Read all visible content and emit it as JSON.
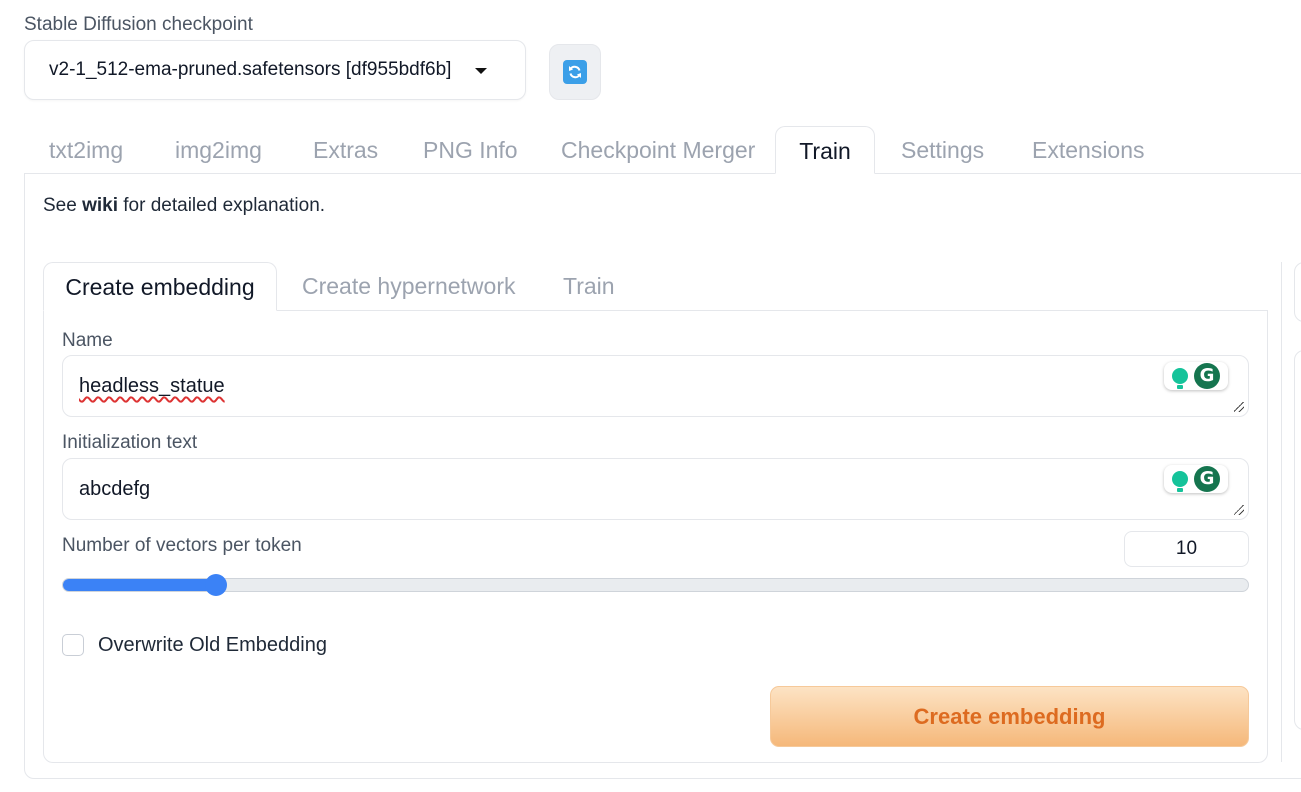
{
  "checkpoint": {
    "label": "Stable Diffusion checkpoint",
    "value": "v2-1_512-ema-pruned.safetensors [df955bdf6b]"
  },
  "colors": {
    "accent": "#3b82f6",
    "primary_button_text": "#dd6b20",
    "primary_button_bg": "#f5b87a"
  },
  "main_tabs": [
    {
      "label": "txt2img",
      "active": false
    },
    {
      "label": "img2img",
      "active": false
    },
    {
      "label": "Extras",
      "active": false
    },
    {
      "label": "PNG Info",
      "active": false
    },
    {
      "label": "Checkpoint Merger",
      "active": false
    },
    {
      "label": "Train",
      "active": true
    },
    {
      "label": "Settings",
      "active": false
    },
    {
      "label": "Extensions",
      "active": false
    }
  ],
  "wiki_line": {
    "prefix": "See",
    "link": "wiki",
    "suffix": "for detailed explanation."
  },
  "sub_tabs": [
    {
      "label": "Create embedding",
      "active": true
    },
    {
      "label": "Create hypernetwork",
      "active": false
    },
    {
      "label": "Train",
      "active": false
    }
  ],
  "form": {
    "name_label": "Name",
    "name_value": "headless_statue",
    "init_label": "Initialization text",
    "init_value": "abcdefg",
    "vectors_label": "Number of vectors per token",
    "vectors_value": "10",
    "vectors_fraction": 0.13,
    "overwrite_label": "Overwrite Old Embedding",
    "overwrite_checked": false,
    "create_button": "Create embedding"
  }
}
